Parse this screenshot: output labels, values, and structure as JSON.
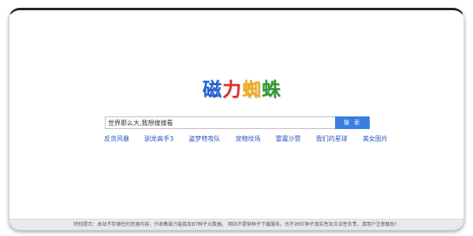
{
  "logo": {
    "chars": [
      "磁",
      "力",
      "蜘",
      "蛛"
    ]
  },
  "search": {
    "value": "世界那么大,我想搜搜看",
    "button_label": "搜 索"
  },
  "quick_links": [
    "反贪风暴",
    "驯龙高手3",
    "盗梦特攻队",
    "宠物坟场",
    "雷霆沙赞",
    "我们的星球",
    "美女图片"
  ],
  "footer": {
    "text": "特别提示：本站不存储任何资源内容，只收集磁力链接及BT种子元数据。 网站不提供种子下载服务，也不对BT种子真实性及合法性负责，请用户注意甄别！"
  }
}
